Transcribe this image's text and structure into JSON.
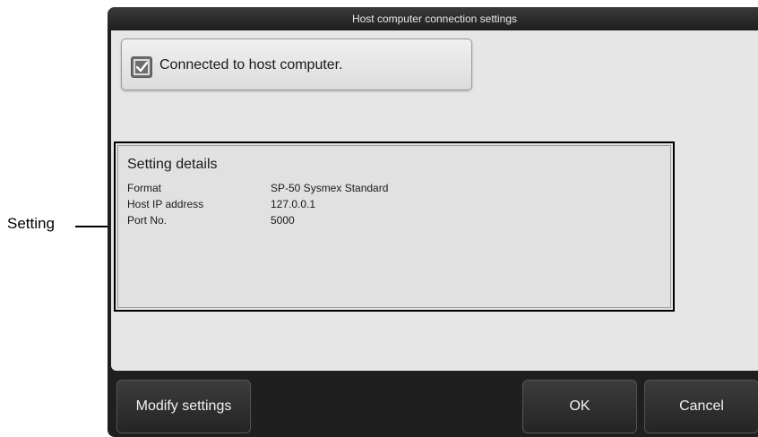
{
  "callout": {
    "label": "Setting"
  },
  "dialog": {
    "title": "Host computer connection settings",
    "checkbox": {
      "label": "Connected to host computer.",
      "checked": true
    },
    "details": {
      "title": "Setting details",
      "rows": [
        {
          "key": "Format",
          "value": "SP-50 Sysmex Standard"
        },
        {
          "key": "Host IP address",
          "value": "127.0.0.1"
        },
        {
          "key": "Port No.",
          "value": "5000"
        }
      ]
    },
    "buttons": {
      "modify": "Modify settings",
      "ok": "OK",
      "cancel": "Cancel"
    }
  }
}
